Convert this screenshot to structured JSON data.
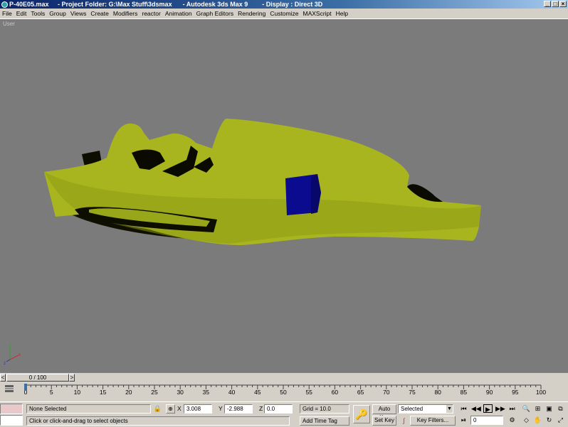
{
  "window": {
    "title": "P-40E05.max     - Project Folder: G:\\Max Stuff\\3dsmax      - Autodesk 3ds Max 9        - Display : Direct 3D",
    "minimize": "_",
    "maximize": "□",
    "close": "×"
  },
  "menu": [
    "File",
    "Edit",
    "Tools",
    "Group",
    "Views",
    "Create",
    "Modifiers",
    "reactor",
    "Animation",
    "Graph Editors",
    "Rendering",
    "Customize",
    "MAXScript",
    "Help"
  ],
  "viewport": {
    "label": "User",
    "background": "#7b7b7b",
    "model_color": "#a9b51f",
    "box_color": "#0b0b8f"
  },
  "timeslider": {
    "prev": "<",
    "position": "0 / 100",
    "next": ">"
  },
  "trackbar": {
    "ticks": [
      "0",
      "5",
      "10",
      "15",
      "20",
      "25",
      "30",
      "35",
      "40",
      "45",
      "50",
      "55",
      "60",
      "65",
      "70",
      "75",
      "80",
      "85",
      "90",
      "95",
      "100"
    ]
  },
  "status": {
    "selection": "None Selected",
    "prompt": "Click or click-and-drag to select objects",
    "x_label": "X",
    "x_value": "3.008",
    "y_label": "Y",
    "y_value": "-2.988",
    "z_label": "Z",
    "z_value": "0.0",
    "grid": "Grid = 10.0",
    "add_time_tag": "Add Time Tag",
    "auto_key": "Auto Key",
    "set_key": "Set Key",
    "key_mode": "Selected",
    "key_filters": "Key Filters...",
    "frame": "0"
  }
}
